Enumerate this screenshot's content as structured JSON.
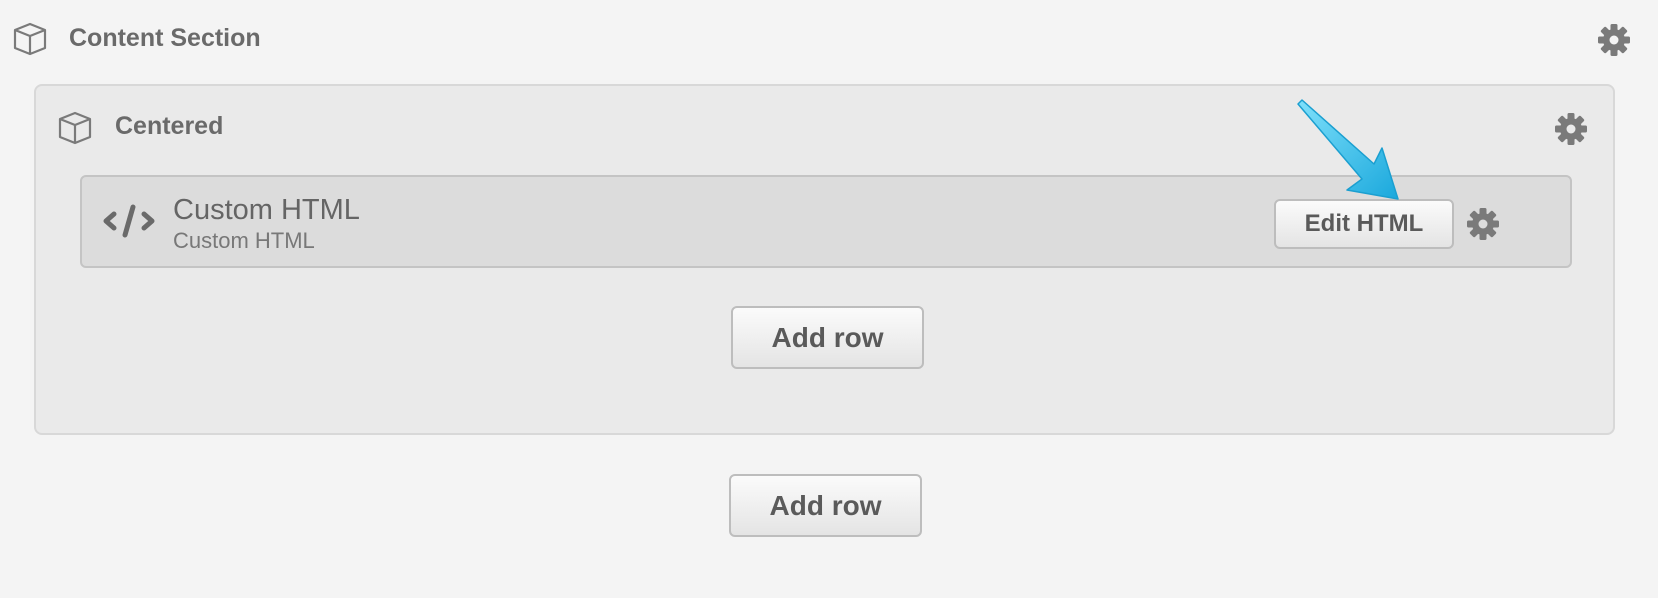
{
  "section": {
    "title": "Content Section",
    "icon": "box-icon",
    "settings_icon": "gear-icon"
  },
  "inner": {
    "title": "Centered",
    "icon": "box-icon",
    "settings_icon": "gear-icon",
    "module": {
      "name": "Custom HTML",
      "type": "Custom HTML",
      "icon": "code-icon",
      "edit_label": "Edit HTML",
      "settings_icon": "gear-icon"
    },
    "add_row_label": "Add row"
  },
  "outer_add_row_label": "Add row",
  "colors": {
    "page_bg": "#f4f4f4",
    "inner_bg": "#eaeaea",
    "module_bg": "#dcdcdc",
    "arrow": "#3cc4ec",
    "text": "#6a6a6a"
  }
}
